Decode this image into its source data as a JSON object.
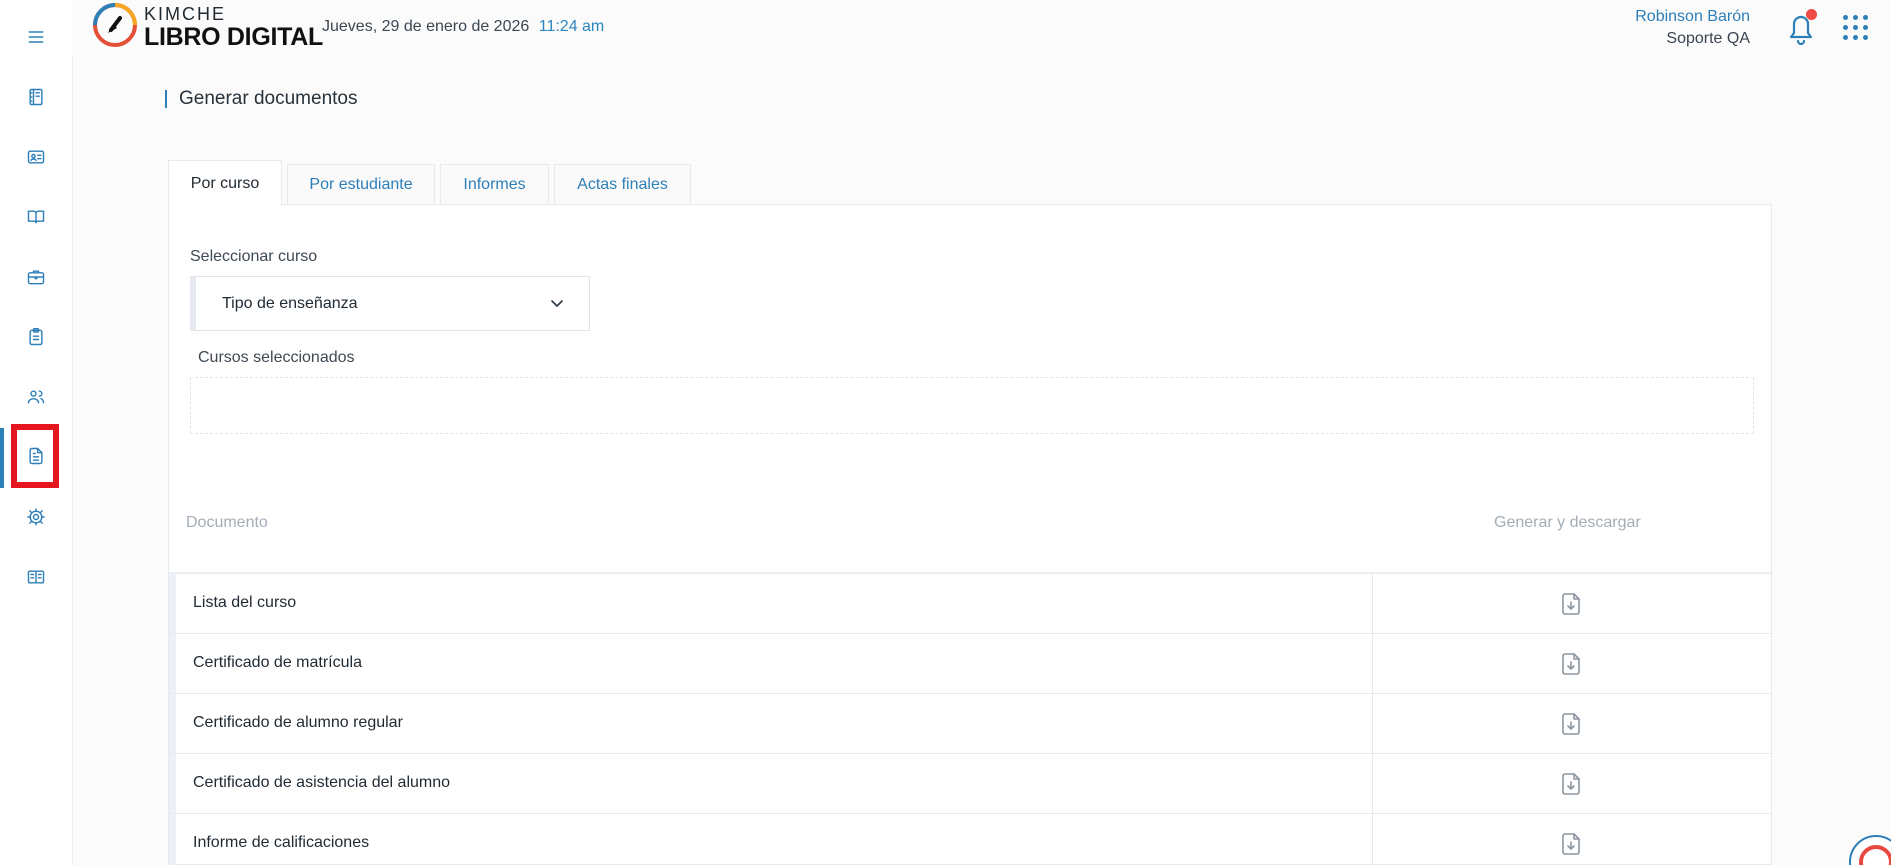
{
  "app": {
    "brand_top": "KIMCHE",
    "brand_bottom": "LIBRO DIGITAL",
    "date": "Jueves, 29 de enero de 2026",
    "time": "11:24 am"
  },
  "user": {
    "name": "Robinson Barón",
    "role": "Soporte QA"
  },
  "sidebar": {
    "items": [
      {
        "icon": "menu-icon"
      },
      {
        "icon": "notebook-icon"
      },
      {
        "icon": "id-card-icon"
      },
      {
        "icon": "open-book-icon"
      },
      {
        "icon": "briefcase-icon"
      },
      {
        "icon": "clipboard-icon"
      },
      {
        "icon": "users-icon"
      },
      {
        "icon": "document-icon",
        "active": true
      },
      {
        "icon": "gear-icon"
      },
      {
        "icon": "book-icon"
      }
    ]
  },
  "page": {
    "title": "Generar documentos"
  },
  "tabs": {
    "items": [
      {
        "label": "Por curso",
        "active": true
      },
      {
        "label": "Por estudiante",
        "active": false
      },
      {
        "label": "Informes",
        "active": false
      },
      {
        "label": "Actas finales",
        "active": false
      }
    ]
  },
  "form": {
    "course_label": "Seleccionar curso",
    "course_select_value": "Tipo de enseñanza",
    "selected_courses_label": "Cursos seleccionados"
  },
  "table": {
    "columns": [
      "Documento",
      "Generar y descargar"
    ],
    "rows": [
      {
        "name": "Lista del curso"
      },
      {
        "name": "Certificado de matrícula"
      },
      {
        "name": "Certificado de alumno regular"
      },
      {
        "name": "Certificado de asistencia del alumno"
      },
      {
        "name": "Informe de calificaciones"
      }
    ]
  },
  "colors": {
    "accent": "#2d7fb8",
    "highlight": "#e5161f",
    "notification": "#f04a45",
    "muted": "#a4adb7",
    "page_background": "#fbfbfb"
  }
}
